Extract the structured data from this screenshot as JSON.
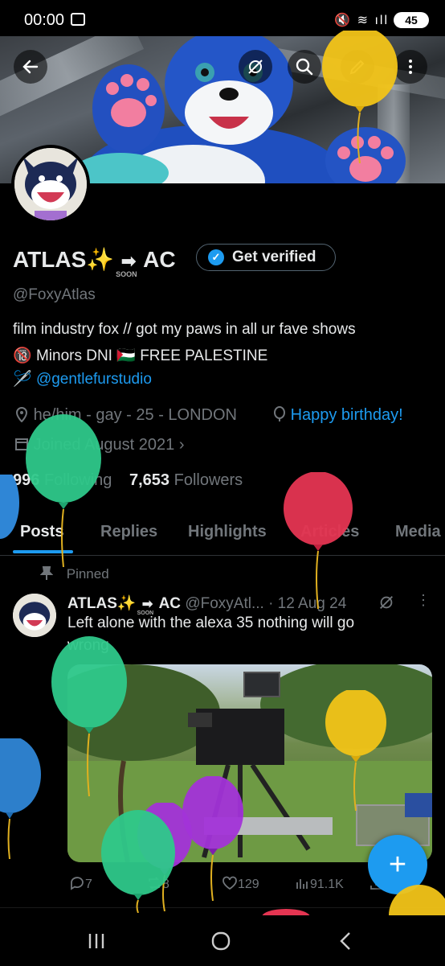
{
  "status_bar": {
    "time": "00:00",
    "icons": "🔇 ≋ ıll",
    "battery": "45"
  },
  "header": {
    "back_label": "back",
    "more_label": "more"
  },
  "profile": {
    "display_name_part1": "ATLAS✨",
    "display_name_arrow": "➡",
    "display_name_soon": "SOON",
    "display_name_part2": "AC",
    "get_verified": "Get verified",
    "handle": "@FoxyAtlas",
    "bio_line1": "film industry fox // got my paws in all ur fave shows",
    "bio_line2_emoji": "🔞",
    "bio_line2_text": " Minors DNI ",
    "bio_line2_flag": "🇵🇸",
    "bio_line2_text2": " FREE PALESTINE",
    "bio_line3_icon": "🪡",
    "bio_line3_link": "@gentlefurstudio",
    "location": "he/him - gay - 25 - LONDON",
    "birthday": "Happy birthday!",
    "joined": "Joined August 2021",
    "following_count": "996",
    "following_label": "Following",
    "followers_count": "7,653",
    "followers_label": "Followers"
  },
  "tabs": [
    {
      "label": "Posts"
    },
    {
      "label": "Replies"
    },
    {
      "label": "Highlights"
    },
    {
      "label": "Articles"
    },
    {
      "label": "Media"
    }
  ],
  "tweet": {
    "pinned_label": "Pinned",
    "author_part1": "ATLAS✨",
    "author_arrow": "➡",
    "author_soon": "SOON",
    "author_part2": "AC",
    "handle": "@FoxyAtl...",
    "date": "· 12 Aug 24",
    "text_line1": "Left alone with the alexa 35 nothing will go",
    "text_line2": "wrong",
    "replies": "7",
    "reposts": "8",
    "likes": "129",
    "views": "91.1K"
  },
  "fab": {
    "label": "+"
  },
  "icons": {
    "back": "arrow-left-icon",
    "no_notify": "bell-off-icon",
    "search": "search-icon",
    "edit": "pencil-icon",
    "more": "more-vertical-icon",
    "location": "location-pin-icon",
    "birthday": "balloon-icon",
    "calendar": "calendar-icon",
    "pin": "pin-icon",
    "reply": "reply-icon",
    "repost": "repost-icon",
    "like": "heart-icon",
    "views": "views-icon",
    "share": "share-icon"
  },
  "colors": {
    "accent": "#1d9bf0",
    "background": "#000000",
    "text_primary": "#e7e9ea",
    "text_secondary": "#71767b"
  }
}
